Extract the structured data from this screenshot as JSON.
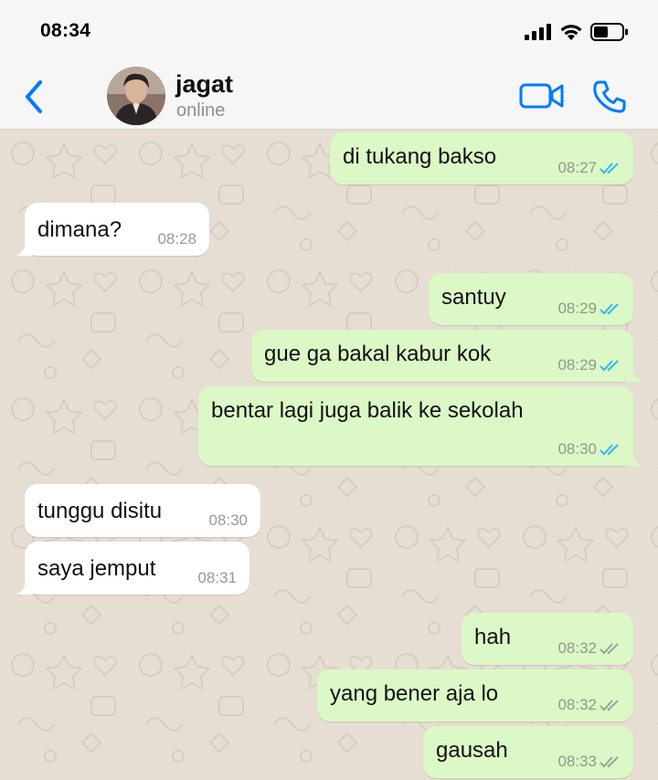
{
  "status_bar": {
    "time": "08:34",
    "icons": [
      "signal-icon",
      "wifi-icon",
      "battery-icon"
    ]
  },
  "header": {
    "contact_name": "jagat",
    "contact_status": "online",
    "accent_color": "#007aff"
  },
  "messages": [
    {
      "direction": "out",
      "text": "di tukang bakso",
      "time": "08:27",
      "ticks": "read"
    },
    {
      "direction": "in",
      "text": "dimana?",
      "time": "08:28"
    },
    {
      "direction": "out",
      "text": "santuy",
      "time": "08:29",
      "ticks": "read"
    },
    {
      "direction": "out",
      "text": "gue ga bakal kabur kok",
      "time": "08:29",
      "ticks": "read"
    },
    {
      "direction": "out",
      "text": "bentar lagi juga balik ke sekolah",
      "time": "08:30",
      "ticks": "read"
    },
    {
      "direction": "in",
      "text": "tunggu disitu",
      "time": "08:30"
    },
    {
      "direction": "in",
      "text": "saya jemput",
      "time": "08:31"
    },
    {
      "direction": "out",
      "text": "hah",
      "time": "08:32",
      "ticks": "delivered"
    },
    {
      "direction": "out",
      "text": "yang bener aja lo",
      "time": "08:32",
      "ticks": "delivered"
    },
    {
      "direction": "out",
      "text": "gausah",
      "time": "08:33",
      "ticks": "delivered"
    }
  ],
  "colors": {
    "outgoing_bubble": "#dcf8c6",
    "incoming_bubble": "#ffffff",
    "read_tick": "#34b7f1",
    "delivered_tick": "#9aa39a",
    "wallpaper": "#e6ded3"
  }
}
